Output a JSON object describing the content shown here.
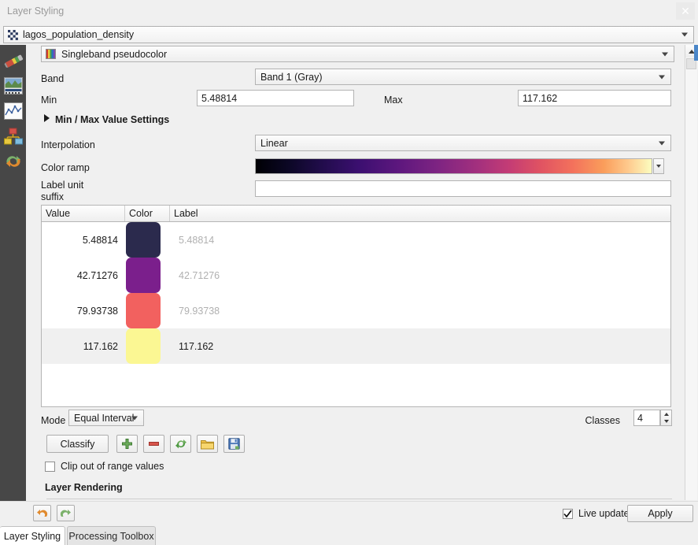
{
  "window": {
    "title": "Layer Styling",
    "close_icon": "close-icon"
  },
  "layer_selector": {
    "name": "lagos_population_density",
    "icon": "raster-layer-icon"
  },
  "rail": {
    "items": [
      {
        "icon": "paintbrush-icon",
        "name": "symbology"
      },
      {
        "icon": "histogram-icon",
        "name": "transparency"
      },
      {
        "icon": "line-chart-icon",
        "name": "histogram"
      },
      {
        "icon": "diagram-icon",
        "name": "rendering"
      },
      {
        "icon": "undo-redo-icon",
        "name": "history"
      }
    ]
  },
  "renderer": {
    "label": "Singleband pseudocolor",
    "icon": "color-ramp-icon"
  },
  "form": {
    "band_label": "Band",
    "band_value": "Band 1 (Gray)",
    "min_label": "Min",
    "min_value": "5.48814",
    "max_label": "Max",
    "max_value": "117.162",
    "minmax_settings_label": "Min / Max Value Settings",
    "interpolation_label": "Interpolation",
    "interpolation_value": "Linear",
    "color_ramp_label": "Color ramp",
    "label_unit_suffix_label_line1": "Label unit",
    "label_unit_suffix_label_line2": "suffix",
    "label_unit_suffix_value": ""
  },
  "table": {
    "headers": [
      "Value",
      "Color",
      "Label"
    ],
    "rows": [
      {
        "value": "5.48814",
        "color": "#2b2a4d",
        "label": "5.48814",
        "selected": false
      },
      {
        "value": "42.71276",
        "color": "#7b1f8c",
        "label": "42.71276",
        "selected": false
      },
      {
        "value": "79.93738",
        "color": "#f2615f",
        "label": "79.93738",
        "selected": false
      },
      {
        "value": "117.162",
        "color": "#fbf793",
        "label": "117.162",
        "selected": true
      }
    ]
  },
  "controls": {
    "mode_label": "Mode",
    "mode_value": "Equal Interval",
    "classes_label": "Classes",
    "classes_value": "4",
    "classify_label": "Classify",
    "add_icon": "plus-icon",
    "delete_icon": "minus-icon",
    "reload_icon": "refresh-icon",
    "load_icon": "folder-icon",
    "save_icon": "save-icon",
    "clip_label": "Clip out of range values",
    "clip_checked": false
  },
  "layer_rendering": {
    "title": "Layer Rendering"
  },
  "bottom": {
    "undo_icon": "undo-icon",
    "redo_icon": "redo-icon",
    "live_update_label": "Live update",
    "live_update_checked": true,
    "apply_label": "Apply"
  },
  "tabs": [
    {
      "label": "Layer Styling",
      "active": true
    },
    {
      "label": "Processing Toolbox",
      "active": false
    }
  ],
  "colors": {
    "rail_bg": "#474747",
    "panel_bg": "#f0f0f0",
    "accent": "#4a86c8",
    "ramp_name": "magma"
  }
}
